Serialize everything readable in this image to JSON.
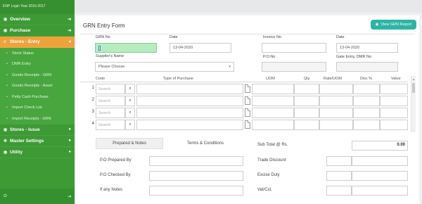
{
  "sidebar": {
    "header": "ENP Login Year 2016-2017",
    "items": [
      {
        "label": "Overview",
        "icon": "dashboard-icon",
        "right": "exit-icon"
      },
      {
        "label": "Purchase",
        "icon": "cart-icon",
        "right": "exit-icon"
      },
      {
        "label": "Stores - Entry",
        "icon": "store-icon",
        "right": "caret-icon"
      }
    ],
    "sub_items": [
      "Stock Status",
      "DMR Entry",
      "Goods Receipts - GRN",
      "Goods Receipts - Asset",
      "Petty Cash Purchase",
      "Import Check List",
      "Import Receipts - GRN"
    ],
    "lower_items": [
      {
        "label": "Stores - Issue",
        "icon": "store-icon"
      },
      {
        "label": "Master Settings",
        "icon": "gear-icon"
      },
      {
        "label": "Utility",
        "icon": "wrench-icon"
      }
    ],
    "bottom": {
      "left_icon": "power-icon",
      "right_icon": "exit-icon"
    }
  },
  "form": {
    "title": "GRN Entry Form",
    "view_button": "View GRN Report",
    "grn_no_label": "GRN No",
    "date_label": "Date",
    "date_value": "13-04-2020",
    "invoice_no_label": "Invoice No",
    "date2_label": "Date",
    "date2_value": "13-04-2020",
    "supplier_label": "Supplier's Name",
    "supplier_value": "Please Choose",
    "po_no_label": "P.O.No",
    "gate_entry_label": "Gate Entry, DMR No"
  },
  "grid": {
    "headers": [
      "Code",
      "Type of Purchase",
      "UOM",
      "Qty",
      "Rate/UOM",
      "Disc %",
      "Value"
    ],
    "search_placeholder": "Search",
    "rows": [
      "1",
      "2",
      "3",
      "4"
    ]
  },
  "bottom": {
    "tabs": [
      "Prepared & Notes",
      "Terms & Conditions"
    ],
    "left_labels": [
      "P.O Prepared By",
      "P.O Checked By",
      "If any Notes"
    ],
    "right_labels": [
      "Sub Total @ Rs.",
      "Trade Discount",
      "Excise Duty",
      "Vat/Cst."
    ],
    "subtotal_value": "0.00"
  }
}
